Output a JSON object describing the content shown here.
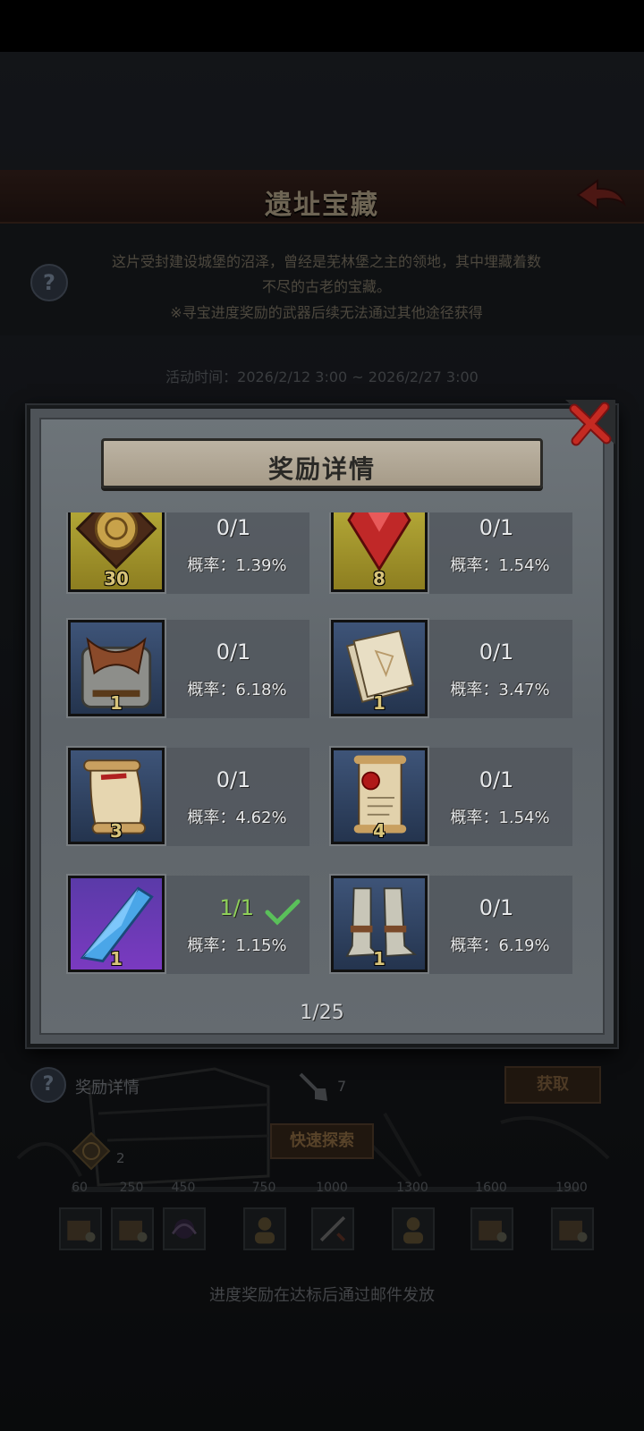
{
  "background": {
    "title": "遗址宝藏",
    "description_line1": "这片受封建设城堡的沼泽，曾经是芜林堡之主的领地，其中埋藏着数",
    "description_line2": "不尽的古老的宝藏。",
    "description_line3": "※寻宝进度奖励的武器后续无法通过其他途径获得",
    "event_time": "活动时间：2026/2/12 3:00 ~ 2026/2/27 3:00",
    "reward_detail_label": "奖励详情",
    "shovel_count": "7",
    "get_button": "获取",
    "quick_explore_button": "快速探索",
    "badge_count": "2",
    "milestones": [
      "60",
      "250",
      "450",
      "750",
      "1000",
      "1300",
      "1600",
      "1900"
    ],
    "footer": "进度奖励在达标后通过邮件发放"
  },
  "modal": {
    "title": "奖励详情",
    "page": "1/25",
    "items": [
      {
        "icon": "gold-rune-tablet-icon",
        "count": "30",
        "progress": "0/1",
        "prob": "概率：1.39%",
        "frame": "gold"
      },
      {
        "icon": "red-gem-icon",
        "count": "8",
        "progress": "0/1",
        "prob": "概率：1.54%",
        "frame": "gold"
      },
      {
        "icon": "chainmail-armor-icon",
        "count": "1",
        "progress": "0/1",
        "prob": "概率：6.18%",
        "frame": "blue"
      },
      {
        "icon": "blueprint-papers-icon",
        "count": "1",
        "progress": "0/1",
        "prob": "概率：3.47%",
        "frame": "blue"
      },
      {
        "icon": "red-scroll-icon",
        "count": "3",
        "progress": "0/1",
        "prob": "概率：4.62%",
        "frame": "blue"
      },
      {
        "icon": "sealed-letter-icon",
        "count": "4",
        "progress": "0/1",
        "prob": "概率：1.54%",
        "frame": "blue"
      },
      {
        "icon": "blue-crystal-icon",
        "count": "1",
        "progress": "1/1",
        "prob": "概率：1.15%",
        "frame": "purple",
        "done": true
      },
      {
        "icon": "iron-boots-icon",
        "count": "1",
        "progress": "0/1",
        "prob": "概率：6.19%",
        "frame": "blue"
      }
    ]
  }
}
